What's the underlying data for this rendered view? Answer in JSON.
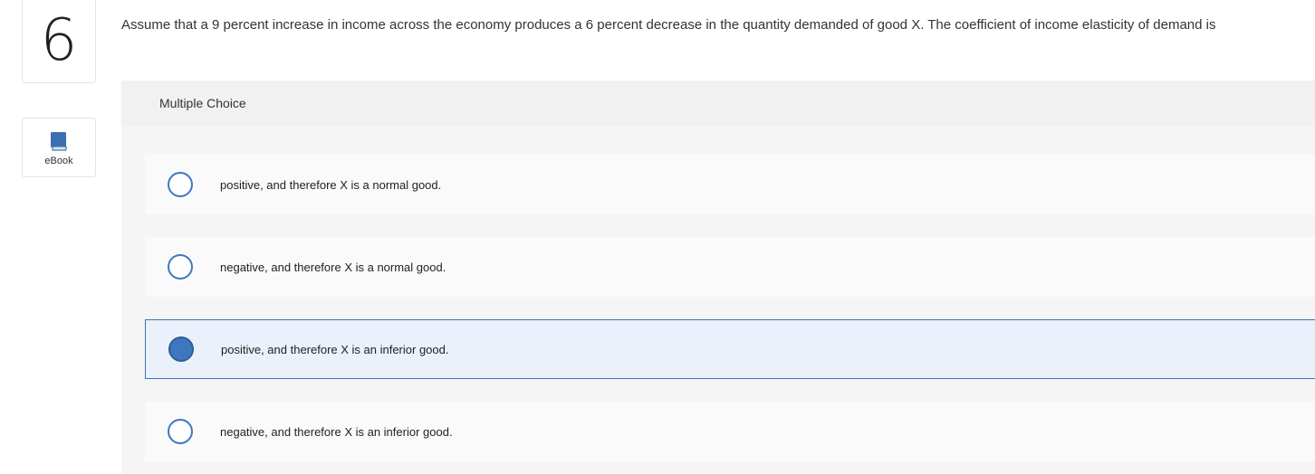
{
  "question": {
    "number": "6",
    "text": "Assume that a 9 percent increase in income across the economy produces a 6 percent decrease in the quantity demanded of good X. The coefficient of income elasticity of demand is"
  },
  "ebook": {
    "label": "eBook",
    "icon": "book-icon"
  },
  "multiple_choice": {
    "header": "Multiple Choice",
    "options": [
      {
        "label": "positive, and therefore X is a normal good.",
        "selected": false
      },
      {
        "label": "negative, and therefore X is a normal good.",
        "selected": false
      },
      {
        "label": "positive, and therefore X is an inferior good.",
        "selected": true
      },
      {
        "label": "negative, and therefore X is an inferior good.",
        "selected": false
      }
    ]
  },
  "colors": {
    "accent": "#3d78bf",
    "selected_background": "#eaf1fb"
  }
}
